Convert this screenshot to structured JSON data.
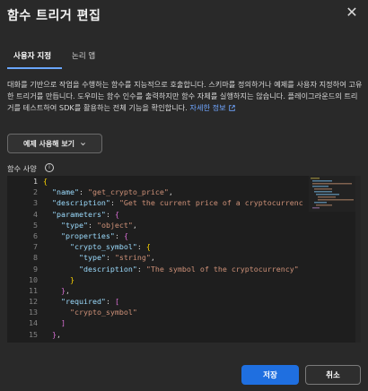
{
  "dialog": {
    "title": "함수 트리거 편집",
    "close_glyph": "✕"
  },
  "tabs": [
    {
      "label": "사용자 지정",
      "active": true
    },
    {
      "label": "논리 앱",
      "active": false
    }
  ],
  "description": {
    "text": "대화를 기반으로 작업을 수행하는 함수를 지능적으로 호출합니다. 스키마를 정의하거나 예제를 사용자 지정하여 고유한 트리거를 만듭니다. 도우미는 함수 인수를 출력하지만 함수 자체를 실행하지는 않습니다. 플레이그라운드의 트리거를 테스트하여 SDK를 활용하는 전체 기능을 확인합니다.",
    "link_label": "자세한 정보"
  },
  "examples_button": {
    "label": "예제 사용해 보기"
  },
  "section": {
    "label": "함수 사양",
    "info_glyph": "i"
  },
  "editor": {
    "line_numbers": [
      "1",
      "2",
      "3",
      "4",
      "5",
      "6",
      "7",
      "8",
      "9",
      "10",
      "11",
      "12",
      "13",
      "14",
      "15"
    ],
    "lines": [
      [
        {
          "c": "brace",
          "t": "{"
        }
      ],
      [
        {
          "c": "key",
          "t": "  \"name\""
        },
        {
          "c": "punc",
          "t": ": "
        },
        {
          "c": "str",
          "t": "\"get_crypto_price\""
        },
        {
          "c": "punc",
          "t": ","
        }
      ],
      [
        {
          "c": "key",
          "t": "  \"description\""
        },
        {
          "c": "punc",
          "t": ": "
        },
        {
          "c": "str",
          "t": "\"Get the current price of a cryptocurrency\""
        },
        {
          "c": "punc",
          "t": ","
        }
      ],
      [
        {
          "c": "key",
          "t": "  \"parameters\""
        },
        {
          "c": "punc",
          "t": ": "
        },
        {
          "c": "brk",
          "t": "{"
        }
      ],
      [
        {
          "c": "key",
          "t": "    \"type\""
        },
        {
          "c": "punc",
          "t": ": "
        },
        {
          "c": "str",
          "t": "\"object\""
        },
        {
          "c": "punc",
          "t": ","
        }
      ],
      [
        {
          "c": "key",
          "t": "    \"properties\""
        },
        {
          "c": "punc",
          "t": ": "
        },
        {
          "c": "brk",
          "t": "{"
        }
      ],
      [
        {
          "c": "key",
          "t": "      \"crypto_symbol\""
        },
        {
          "c": "punc",
          "t": ": "
        },
        {
          "c": "brace",
          "t": "{"
        }
      ],
      [
        {
          "c": "key",
          "t": "        \"type\""
        },
        {
          "c": "punc",
          "t": ": "
        },
        {
          "c": "str",
          "t": "\"string\""
        },
        {
          "c": "punc",
          "t": ","
        }
      ],
      [
        {
          "c": "key",
          "t": "        \"description\""
        },
        {
          "c": "punc",
          "t": ": "
        },
        {
          "c": "str",
          "t": "\"The symbol of the cryptocurrency\""
        }
      ],
      [
        {
          "c": "brace",
          "t": "      }"
        }
      ],
      [
        {
          "c": "brk",
          "t": "    }"
        },
        {
          "c": "punc",
          "t": ","
        }
      ],
      [
        {
          "c": "key",
          "t": "    \"required\""
        },
        {
          "c": "punc",
          "t": ": "
        },
        {
          "c": "brk",
          "t": "["
        }
      ],
      [
        {
          "c": "str",
          "t": "      \"crypto_symbol\""
        }
      ],
      [
        {
          "c": "brk",
          "t": "    ]"
        }
      ],
      [
        {
          "c": "brk",
          "t": "  }"
        },
        {
          "c": "punc",
          "t": ","
        }
      ]
    ]
  },
  "footer": {
    "save_label": "저장",
    "cancel_label": "취소"
  },
  "colors": {
    "accent": "#1f6fe0",
    "link": "#70a6ff",
    "editor_bg": "#1e1e1e"
  }
}
